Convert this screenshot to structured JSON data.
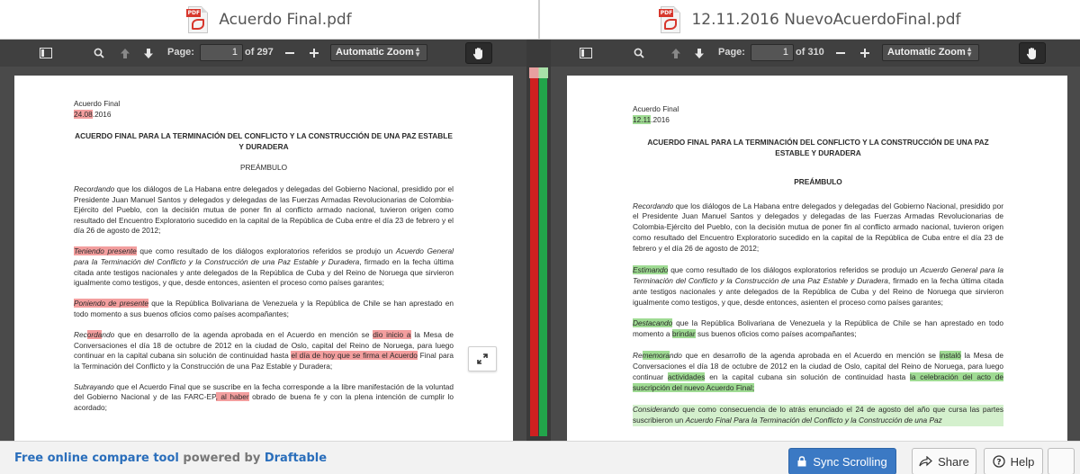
{
  "left": {
    "file_name": "Acuerdo Final.pdf",
    "toolbar": {
      "page_label": "Page:",
      "page_value": "1",
      "page_total": "of 297",
      "zoom": "Automatic Zoom"
    },
    "doc": {
      "header1": "Acuerdo Final",
      "date_changed": "24.08",
      "date_rest": ".2016",
      "title": "ACUERDO FINAL PARA LA TERMINACIÓN DEL CONFLICTO Y LA CONSTRUCCIÓN DE UNA PAZ ESTABLE Y DURADERA",
      "preamble": "PREÁMBULO",
      "p1_lead": "Recordando",
      "p1_rest": " que los diálogos de La Habana entre delegados y delegadas del Gobierno Nacional, presidido por el Presidente Juan Manuel Santos y delegados y delegadas de las Fuerzas Armadas Revolucionarias de Colombia-Ejército del Pueblo, con la decisión mutua de poner fin al conflicto armado nacional, tuvieron origen como resultado del Encuentro Exploratorio sucedido en la capital de la República de Cuba entre el día 23 de febrero y el día 26 de agosto de 2012;",
      "p2_lead": "Teniendo presente",
      "p2_mid": " que como resultado de los diálogos exploratorios referidos se produjo un ",
      "p2_ital": "Acuerdo General para la Terminación del Conflicto y la Construcción de una Paz Estable y Duradera",
      "p2_rest": ", firmado en la fecha última citada ante testigos nacionales y ante delegados de la República de Cuba y del Reino de Noruega que sirvieron igualmente como testigos, y que, desde entonces, asienten el proceso como países garantes;",
      "p3_lead": "Poniendo de presente",
      "p3_rest": " que la República Bolivariana de Venezuela y la República de Chile se han aprestado en todo momento a sus buenos oficios como países acompañantes;",
      "p4_a": "Rec",
      "p4_b": "orda",
      "p4_c": "ndo",
      "p4_d": " que en desarrollo de la agenda aprobada en el Acuerdo en mención se ",
      "p4_e": "dio inicio a",
      "p4_f": " la Mesa de Conversaciones el día 18 de octubre de 2012 en la ciudad de Oslo, capital del Reino de Noruega, para luego continuar en la capital cubana sin solución de continuidad hasta ",
      "p4_g": "el día de hoy que se firma el Acuerdo",
      "p4_h": " Final para la Terminación del Conflicto y la Construcción de una Paz Estable y Duradera;",
      "p5_lead": "Subrayando",
      "p5_mid": " que el Acuerdo Final que se suscribe en la fecha corresponde a la libre manifestación de la voluntad del Gobierno Nacional y de las FARC-EP",
      "p5_del": ", al haber",
      "p5_rest": " obrado de buena fe y con la plena intención de cumplir lo acordado;"
    }
  },
  "right": {
    "file_name": "12.11.2016 NuevoAcuerdoFinal.pdf",
    "toolbar": {
      "page_label": "Page:",
      "page_value": "1",
      "page_total": "of 310",
      "zoom": "Automatic Zoom"
    },
    "doc": {
      "header1": "Acuerdo Final",
      "date_changed": "12.11",
      "date_rest": ".2016",
      "title": "ACUERDO FINAL PARA LA TERMINACIÓN DEL CONFLICTO Y LA CONSTRUCCIÓN DE UNA PAZ ESTABLE Y DURADERA",
      "preamble": "PREÁMBULO",
      "p1_lead": "Recordando",
      "p1_rest": " que los diálogos de La Habana entre delegados y delegadas del Gobierno Nacional, presidido por el Presidente Juan Manuel Santos y delegados y delegadas de las Fuerzas Armadas Revolucionarias de Colombia-Ejército del Pueblo, con la decisión mutua de poner fin al conflicto armado nacional, tuvieron origen como resultado del Encuentro Exploratorio sucedido en la capital de la República de Cuba entre el día 23 de febrero y el día 26 de agosto de 2012;",
      "p2_lead": "Estimando",
      "p2_mid": " que como resultado de los diálogos exploratorios referidos se produjo un ",
      "p2_ital": "Acuerdo General para la Terminación del Conflicto y la Construcción de una Paz Estable y Duradera",
      "p2_rest": ", firmado en la fecha última citada ante testigos nacionales y ante delegados de la República de Cuba y del Reino de Noruega que sirvieron igualmente como testigos, y que, desde entonces, asienten el proceso como países garantes;",
      "p3_lead": "Destacando",
      "p3_mid": " que la República Bolivariana de Venezuela y la República de Chile se han aprestado en todo momento a ",
      "p3_ins": "brindar",
      "p3_rest": " sus buenos oficios como países acompañantes;",
      "p4_a": "Re",
      "p4_b": "memora",
      "p4_c": "ndo",
      "p4_d": " que en desarrollo de la agenda aprobada en el Acuerdo en mención se ",
      "p4_e": "instaló",
      "p4_f": " la Mesa de Conversaciones el día 18 de octubre de 2012 en la ciudad de Oslo, capital del Reino de Noruega, para luego continuar ",
      "p4_g": "actividades",
      "p4_h": " en la capital cubana sin solución de continuidad hasta ",
      "p4_i": "la celebración del acto de suscripción del nuevo Acuerdo Final;",
      "p5_lead": "Considerando",
      "p5_mid": " que como consecuencia de lo atrás enunciado el 24 de agosto del año que cursa las partes suscribieron un ",
      "p5_ital": "Acuerdo Final Para la Terminación del Conflicto y la Construcción de una Paz"
    }
  },
  "footer": {
    "text_a": "Free online compare tool",
    "text_b": " powered by ",
    "text_c": "Draftable",
    "sync_label": "Sync Scrolling",
    "share_label": "Share",
    "help_label": "Help"
  },
  "colors": {
    "deleted": "#f7c9c9",
    "inserted": "#c8ecc0",
    "toolbar": "#404040",
    "viewer_bg": "#4a4a4a",
    "sync_button": "#3b79c4",
    "link": "#2a6ebb"
  }
}
